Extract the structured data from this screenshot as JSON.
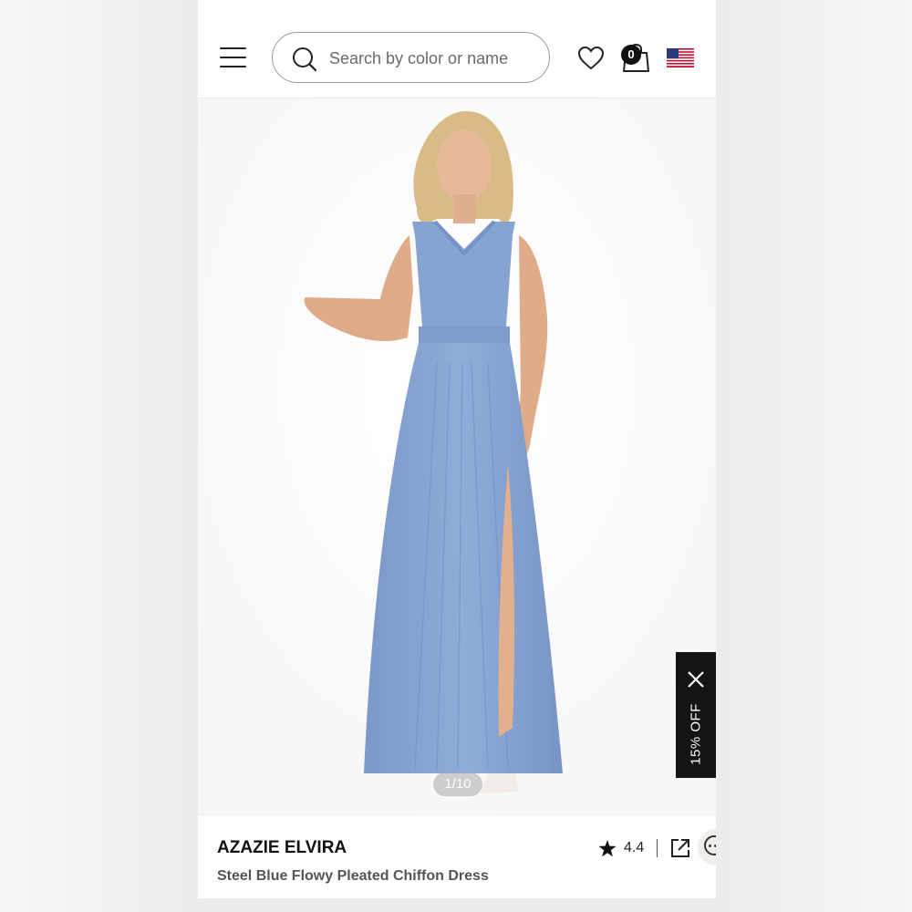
{
  "search": {
    "placeholder": "Search by color or name"
  },
  "header": {
    "cart_count": "0",
    "icons": [
      "menu-icon",
      "search-icon",
      "heart-icon",
      "shopping-bag-icon",
      "us-flag-icon"
    ]
  },
  "gallery": {
    "counter": "1/10",
    "dress_color": "#87a4d3"
  },
  "promo": {
    "label": "15% OFF"
  },
  "product": {
    "brand": "AZAZIE ELVIRA",
    "name": "Steel Blue Flowy Pleated Chiffon Dress",
    "rating": "4.4"
  },
  "colors": {
    "accent": "#141414",
    "dress": "#87a4d3"
  }
}
